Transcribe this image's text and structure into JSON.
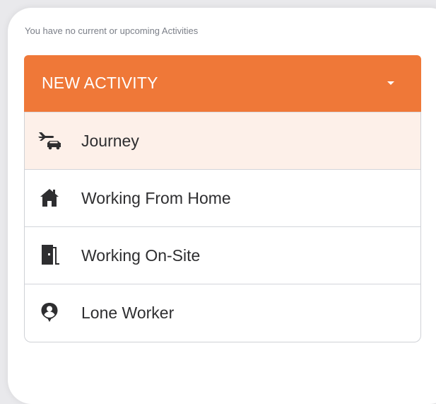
{
  "status": {
    "empty_message": "You have no current or upcoming Activities"
  },
  "dropdown": {
    "label": "NEW ACTIVITY",
    "caret_icon": "caret-down-icon",
    "accent_color": "#ef7838",
    "items": [
      {
        "label": "Journey",
        "icon": "plane-car-icon",
        "highlighted": true
      },
      {
        "label": "Working From Home",
        "icon": "home-icon",
        "highlighted": false
      },
      {
        "label": "Working On-Site",
        "icon": "building-door-icon",
        "highlighted": false
      },
      {
        "label": "Lone Worker",
        "icon": "person-pin-icon",
        "highlighted": false
      }
    ]
  }
}
